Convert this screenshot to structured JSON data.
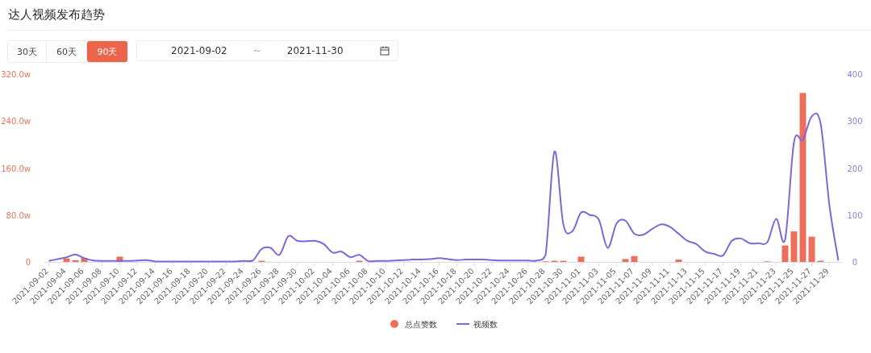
{
  "title": "达人视频发布趋势",
  "ranges": [
    {
      "label": "30天",
      "selected": false
    },
    {
      "label": "60天",
      "selected": false
    },
    {
      "label": "90天",
      "selected": true
    }
  ],
  "date_range": {
    "start": "2021-09-02",
    "separator": "~",
    "end": "2021-11-30"
  },
  "chart_data": {
    "type": "bar",
    "stacked": false,
    "legend": "bottom",
    "categories": [
      "2021-09-02",
      null,
      "2021-09-04",
      null,
      "2021-09-06",
      null,
      "2021-09-08",
      null,
      "2021-09-10",
      null,
      "2021-09-12",
      null,
      "2021-09-14",
      null,
      "2021-09-16",
      null,
      "2021-09-18",
      null,
      "2021-09-20",
      null,
      "2021-09-22",
      null,
      "2021-09-24",
      null,
      "2021-09-26",
      null,
      "2021-09-28",
      null,
      "2021-09-30",
      null,
      "2021-10-02",
      null,
      "2021-10-04",
      null,
      "2021-10-06",
      null,
      "2021-10-08",
      null,
      "2021-10-10",
      null,
      "2021-10-12",
      null,
      "2021-10-14",
      null,
      "2021-10-16",
      null,
      "2021-10-18",
      null,
      "2021-10-20",
      null,
      "2021-10-22",
      null,
      "2021-10-24",
      null,
      "2021-10-26",
      null,
      "2021-10-28",
      null,
      "2021-10-30",
      null,
      "2021-11-01",
      null,
      "2021-11-03",
      null,
      "2021-11-05",
      null,
      "2021-11-07",
      null,
      "2021-11-09",
      null,
      "2021-11-11",
      null,
      "2021-11-13",
      null,
      "2021-11-15",
      null,
      "2021-11-17",
      null,
      "2021-11-19",
      null,
      "2021-11-21",
      null,
      "2021-11-23",
      null,
      "2021-11-25",
      null,
      "2021-11-27",
      null,
      "2021-11-29",
      null
    ],
    "series": [
      {
        "name": "总点赞数",
        "type": "bar",
        "color": "#ec6f5b",
        "values": [
          0,
          0,
          6,
          3,
          7,
          0,
          0,
          0,
          9,
          0,
          0,
          0,
          0,
          0,
          0,
          0,
          0,
          0,
          0,
          0,
          0,
          0,
          0,
          0,
          2,
          0,
          0,
          0,
          0,
          0,
          0,
          0,
          0,
          0,
          0,
          2,
          0,
          0,
          0,
          0,
          0,
          0,
          0,
          0,
          0,
          0,
          0,
          0,
          0,
          0,
          0,
          0,
          0,
          0,
          0,
          0,
          1,
          2,
          2,
          0,
          9,
          0,
          0,
          0,
          0,
          5,
          10,
          0,
          0,
          0,
          0,
          4,
          0,
          0,
          0,
          0,
          0,
          0,
          0,
          0,
          0,
          1,
          0,
          28,
          52,
          288,
          43,
          2,
          0,
          0
        ]
      },
      {
        "name": "视频数",
        "type": "line",
        "axis": "y2",
        "color": "#7f66d9",
        "values": [
          2,
          6,
          10,
          16,
          8,
          3,
          2,
          2,
          2,
          2,
          3,
          4,
          1,
          1,
          1,
          1,
          1,
          1,
          1,
          1,
          1,
          1,
          2,
          3,
          28,
          30,
          15,
          55,
          45,
          44,
          45,
          38,
          20,
          22,
          10,
          15,
          2,
          2,
          2,
          3,
          4,
          5,
          5,
          6,
          8,
          6,
          4,
          5,
          5,
          5,
          4,
          3,
          3,
          3,
          3,
          3,
          15,
          235,
          80,
          65,
          105,
          100,
          90,
          30,
          82,
          88,
          60,
          58,
          70,
          80,
          75,
          60,
          45,
          38,
          22,
          17,
          14,
          45,
          50,
          40,
          40,
          42,
          92,
          48,
          255,
          260,
          310,
          295,
          120,
          3
        ]
      }
    ],
    "ylim": [
      0,
      320
    ],
    "yticks": [
      {
        "value": 0,
        "label": "0"
      },
      {
        "value": 80,
        "label": "80.0w"
      },
      {
        "value": 160,
        "label": "160.0w"
      },
      {
        "value": 240,
        "label": "240.0w"
      },
      {
        "value": 320,
        "label": "320.0w"
      }
    ],
    "y2lim": [
      0,
      400
    ],
    "y2ticks": [
      0,
      100,
      200,
      300,
      400
    ]
  }
}
